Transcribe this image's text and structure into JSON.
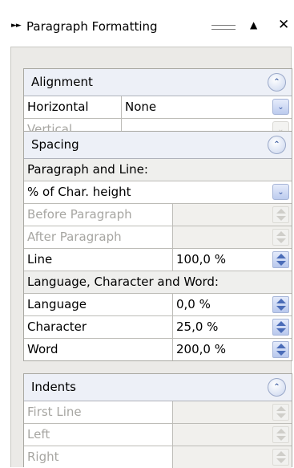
{
  "title": "Paragraph Formatting",
  "alignment": {
    "header": "Alignment",
    "horizontal_label": "Horizontal",
    "horizontal_value": "None",
    "vertical_label": "Vertical",
    "vertical_value": ""
  },
  "spacing": {
    "header": "Spacing",
    "paragraph_and_line_label": "Paragraph and Line:",
    "unit_value": "% of Char. height",
    "before_label": "Before Paragraph",
    "after_label": "After Paragraph",
    "line_label": "Line",
    "line_value": "100,0 %",
    "lang_char_word_label": "Language, Character and Word:",
    "language_label": "Language",
    "language_value": "0,0 %",
    "character_label": "Character",
    "character_value": "25,0 %",
    "word_label": "Word",
    "word_value": "200,0 %"
  },
  "indents": {
    "header": "Indents",
    "first_line_label": "First Line",
    "left_label": "Left",
    "right_label": "Right"
  },
  "colors": {
    "section_header_bg": "#edf0f7",
    "accent_blue": "#4a6cb8",
    "disabled_text": "#a7a6a2"
  }
}
